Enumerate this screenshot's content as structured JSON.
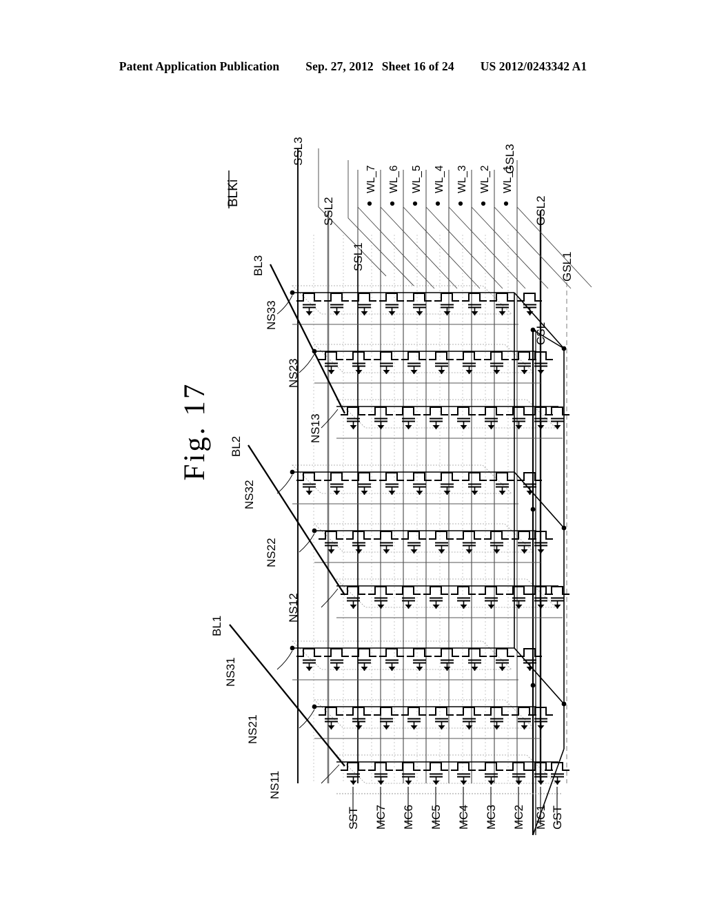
{
  "header": {
    "publication": "Patent Application Publication",
    "date": "Sep. 27, 2012",
    "sheet": "Sheet 16 of 24",
    "number": "US 2012/0243342 A1"
  },
  "figure": {
    "title": "Fig.  17",
    "block_label": "BLKi",
    "bit_lines": [
      "BL1",
      "BL2",
      "BL3"
    ],
    "string_select_lines": [
      "SSL1",
      "SSL2",
      "SSL3"
    ],
    "ground_select_lines": [
      "GSL1",
      "GSL2",
      "GSL3"
    ],
    "common_source_line": "CSL",
    "word_lines": [
      "WL_1",
      "WL_2",
      "WL_3",
      "WL_4",
      "WL_5",
      "WL_6",
      "WL_7"
    ],
    "word_lines_top_to_bottom": [
      "WL_7",
      "WL_6",
      "WL_5",
      "WL_4",
      "WL_3",
      "WL_2",
      "WL_1"
    ],
    "cell_labels": [
      "SST",
      "MC7",
      "MC6",
      "MC5",
      "MC4",
      "MC3",
      "MC2",
      "MC1",
      "GST"
    ],
    "nand_strings": [
      "NS11",
      "NS21",
      "NS31",
      "NS12",
      "NS22",
      "NS32",
      "NS13",
      "NS23",
      "NS33"
    ],
    "colors": {
      "ink": "#000000",
      "mid": "#555555",
      "faint": "#aaaaaa",
      "paper": "#ffffff"
    }
  }
}
